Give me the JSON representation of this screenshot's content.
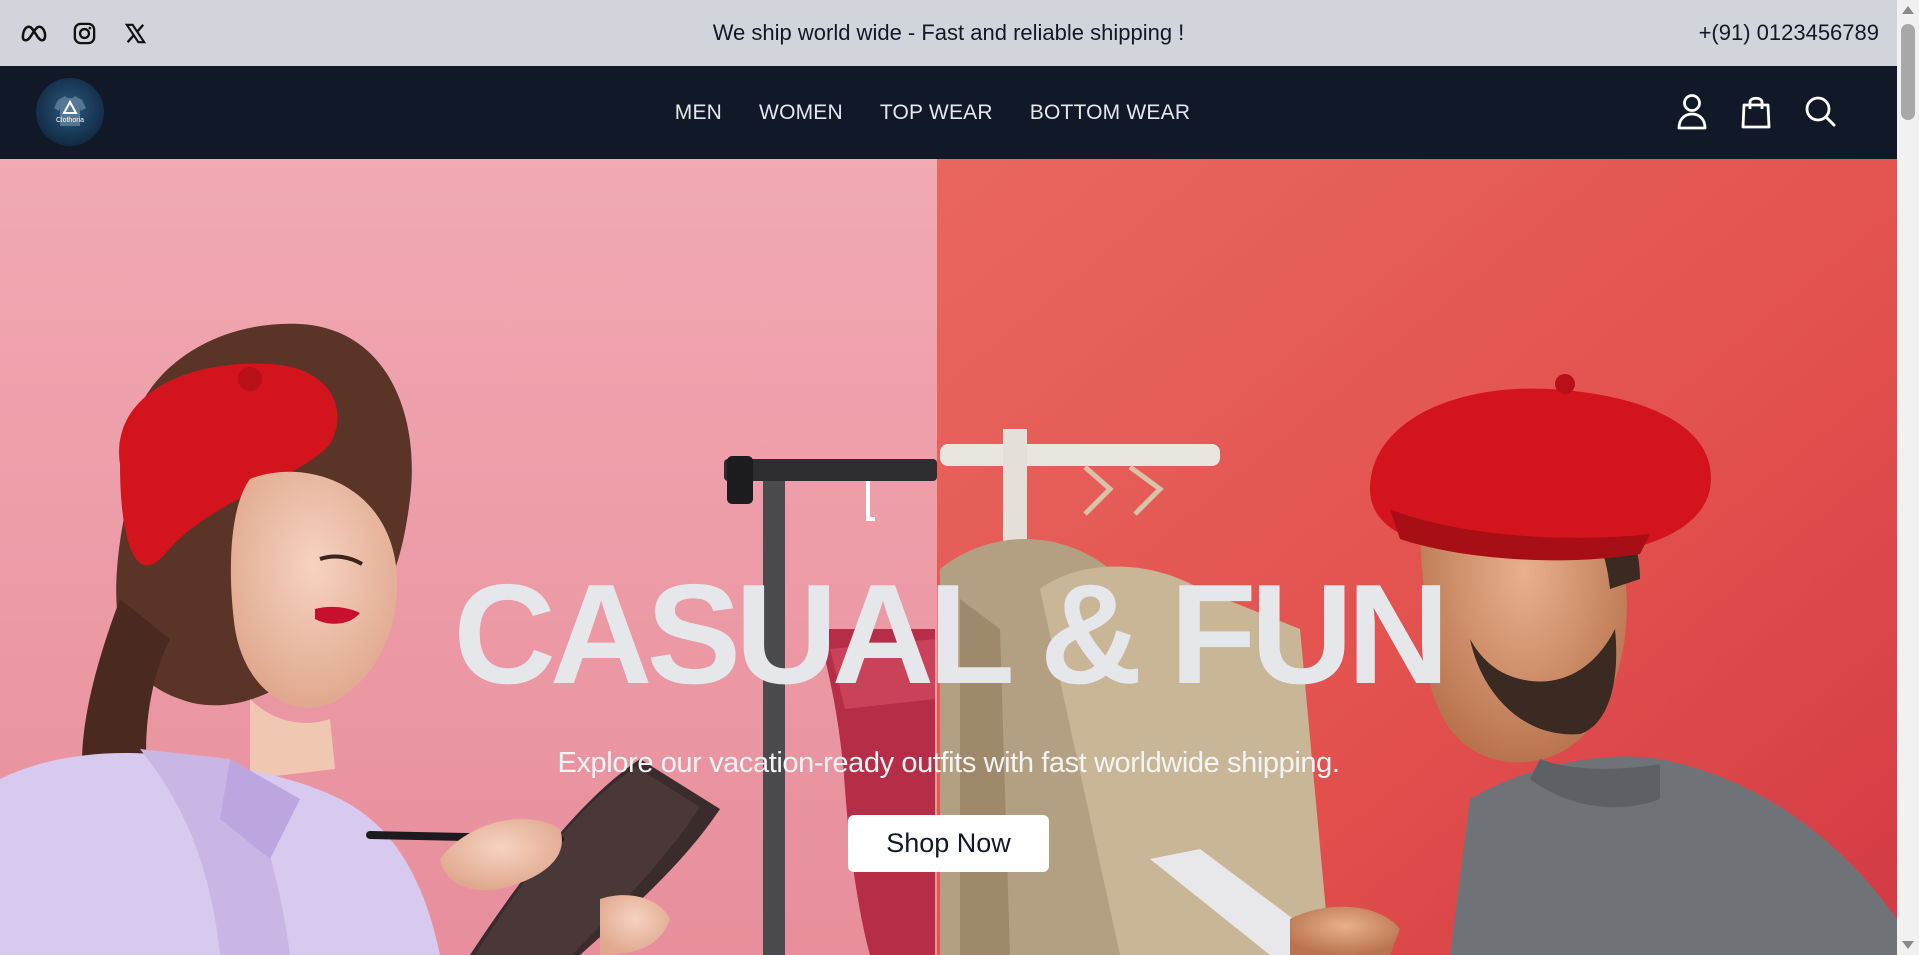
{
  "topbar": {
    "social_icons": [
      "meta-icon",
      "instagram-icon",
      "x-icon"
    ],
    "announcement": "We ship world wide - Fast and reliable shipping !",
    "phone": "+(91) 0123456789"
  },
  "nav": {
    "logo_text": "Clothoria",
    "links": [
      "MEN",
      "WOMEN",
      "TOP WEAR",
      "BOTTOM WEAR"
    ],
    "icons": [
      "user-icon",
      "shopping-bag-icon",
      "search-icon"
    ]
  },
  "hero": {
    "title": "CASUAL & FUN",
    "subtitle": "Explore our vacation-ready outfits with fast worldwide shipping.",
    "cta_label": "Shop Now"
  },
  "colors": {
    "topbar_bg": "#d1d5db",
    "nav_bg": "#111827",
    "hero_left_bg": "#eea3ae",
    "hero_right_bg": "#e85f5a",
    "beret_red": "#d4141c",
    "cta_bg": "#ffffff"
  }
}
